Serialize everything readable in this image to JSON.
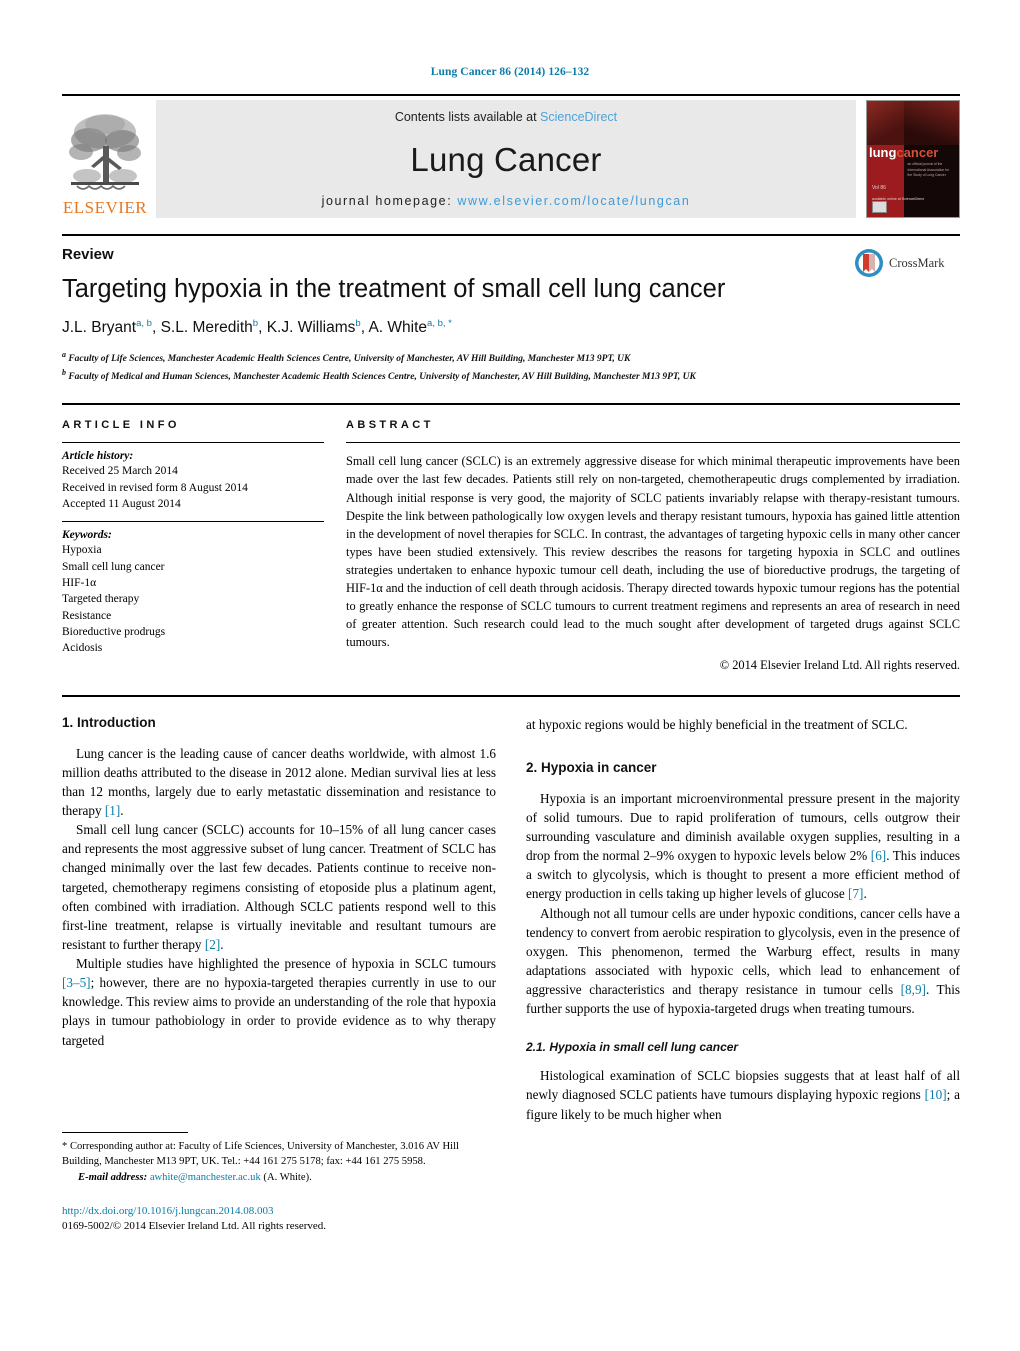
{
  "running_head": "Lung Cancer 86 (2014) 126–132",
  "masthead": {
    "contents_prefix": "Contents lists available at ",
    "contents_link": "ScienceDirect",
    "journal_title": "Lung Cancer",
    "homepage_prefix": "journal homepage: ",
    "homepage_url": "www.elsevier.com/locate/lungcan",
    "publisher": "ELSEVIER",
    "cover": {
      "title_part1": "lung",
      "title_part2": "cancer",
      "subtitle": "an official journal of the International Association for the Study of Lung Cancer",
      "issue_line": "Vol 86",
      "extra_line": "available online at ScienceDirect"
    }
  },
  "article": {
    "kind": "Review",
    "title": "Targeting hypoxia in the treatment of small cell lung cancer",
    "authors_plain": "J.L. Bryant, S.L. Meredith, K.J. Williams, A. White",
    "authors": [
      {
        "name": "J.L. Bryant",
        "marks": "a, b"
      },
      {
        "name": "S.L. Meredith",
        "marks": "b"
      },
      {
        "name": "K.J. Williams",
        "marks": "b"
      },
      {
        "name": "A. White",
        "marks": "a, b, *"
      }
    ],
    "affiliations": [
      {
        "mark": "a",
        "text": "Faculty of Life Sciences, Manchester Academic Health Sciences Centre, University of Manchester, AV Hill Building, Manchester M13 9PT, UK"
      },
      {
        "mark": "b",
        "text": "Faculty of Medical and Human Sciences, Manchester Academic Health Sciences Centre, University of Manchester, AV Hill Building, Manchester M13 9PT, UK"
      }
    ],
    "crossmark_label": "CrossMark"
  },
  "article_info": {
    "heading": "ARTICLE INFO",
    "history_head": "Article history:",
    "history": [
      "Received 25 March 2014",
      "Received in revised form 8 August 2014",
      "Accepted 11 August 2014"
    ],
    "keywords_head": "Keywords:",
    "keywords": [
      "Hypoxia",
      "Small cell lung cancer",
      "HIF-1α",
      "Targeted therapy",
      "Resistance",
      "Bioreductive prodrugs",
      "Acidosis"
    ]
  },
  "abstract": {
    "heading": "ABSTRACT",
    "text": "Small cell lung cancer (SCLC) is an extremely aggressive disease for which minimal therapeutic improvements have been made over the last few decades. Patients still rely on non-targeted, chemotherapeutic drugs complemented by irradiation. Although initial response is very good, the majority of SCLC patients invariably relapse with therapy-resistant tumours. Despite the link between pathologically low oxygen levels and therapy resistant tumours, hypoxia has gained little attention in the development of novel therapies for SCLC. In contrast, the advantages of targeting hypoxic cells in many other cancer types have been studied extensively. This review describes the reasons for targeting hypoxia in SCLC and outlines strategies undertaken to enhance hypoxic tumour cell death, including the use of bioreductive prodrugs, the targeting of HIF-1α and the induction of cell death through acidosis. Therapy directed towards hypoxic tumour regions has the potential to greatly enhance the response of SCLC tumours to current treatment regimens and represents an area of research in need of greater attention. Such research could lead to the much sought after development of targeted drugs against SCLC tumours.",
    "copyright": "© 2014 Elsevier Ireland Ltd. All rights reserved."
  },
  "body": {
    "left_column": {
      "section_heading": "1.  Introduction",
      "paragraphs": [
        {
          "segments": [
            {
              "t": "Lung cancer is the leading cause of cancer deaths worldwide, with almost 1.6 million deaths attributed to the disease in 2012 alone. Median survival lies at less than 12 months, largely due to early metastatic dissemination and resistance to therapy ",
              "k": "text"
            },
            {
              "t": "[1]",
              "k": "ref"
            },
            {
              "t": ".",
              "k": "text"
            }
          ]
        },
        {
          "segments": [
            {
              "t": "Small cell lung cancer (SCLC) accounts for 10–15% of all lung cancer cases and represents the most aggressive subset of lung cancer. Treatment of SCLC has changed minimally over the last few decades. Patients continue to receive non-targeted, chemotherapy regimens consisting of etoposide plus a platinum agent, often combined with irradiation. Although SCLC patients respond well to this first-line treatment, relapse is virtually inevitable and resultant tumours are resistant to further therapy ",
              "k": "text"
            },
            {
              "t": "[2]",
              "k": "ref"
            },
            {
              "t": ".",
              "k": "text"
            }
          ]
        },
        {
          "segments": [
            {
              "t": "Multiple studies have highlighted the presence of hypoxia in SCLC tumours ",
              "k": "text"
            },
            {
              "t": "[3–5]",
              "k": "ref"
            },
            {
              "t": "; however, there are no hypoxia-targeted therapies currently in use to our knowledge. This review aims to provide an understanding of the role that hypoxia plays in tumour pathobiology in order to provide evidence as to why therapy targeted",
              "k": "text"
            }
          ]
        }
      ]
    },
    "right_column": {
      "continued_paragraph": {
        "segments": [
          {
            "t": "at hypoxic regions would be highly beneficial in the treatment of SCLC.",
            "k": "text"
          }
        ]
      },
      "section_heading": "2.  Hypoxia in cancer",
      "paragraphs": [
        {
          "segments": [
            {
              "t": "Hypoxia is an important microenvironmental pressure present in the majority of solid tumours. Due to rapid proliferation of tumours, cells outgrow their surrounding vasculature and diminish available oxygen supplies, resulting in a drop from the normal 2–9% oxygen to hypoxic levels below 2% ",
              "k": "text"
            },
            {
              "t": "[6]",
              "k": "ref"
            },
            {
              "t": ". This induces a switch to glycolysis, which is thought to present a more efficient method of energy production in cells taking up higher levels of glucose ",
              "k": "text"
            },
            {
              "t": "[7]",
              "k": "ref"
            },
            {
              "t": ".",
              "k": "text"
            }
          ]
        },
        {
          "segments": [
            {
              "t": "Although not all tumour cells are under hypoxic conditions, cancer cells have a tendency to convert from aerobic respiration to glycolysis, even in the presence of oxygen. This phenomenon, termed the Warburg effect, results in many adaptations associated with hypoxic cells, which lead to enhancement of aggressive characteristics and therapy resistance in tumour cells ",
              "k": "text"
            },
            {
              "t": "[8,9]",
              "k": "ref"
            },
            {
              "t": ". This further supports the use of hypoxia-targeted drugs when treating tumours.",
              "k": "text"
            }
          ]
        }
      ],
      "subsection_heading": "2.1.  Hypoxia in small cell lung cancer",
      "subsection_paragraphs": [
        {
          "segments": [
            {
              "t": "Histological examination of SCLC biopsies suggests that at least half of all newly diagnosed SCLC patients have tumours displaying hypoxic regions ",
              "k": "text"
            },
            {
              "t": "[10]",
              "k": "ref"
            },
            {
              "t": "; a figure likely to be much higher when",
              "k": "text"
            }
          ]
        }
      ]
    }
  },
  "footnote": {
    "corresponding": "* Corresponding author at: Faculty of Life Sciences, University of Manchester, 3.016 AV Hill Building, Manchester M13 9PT, UK. Tel.: +44 161 275 5178; fax: +44 161 275 5958.",
    "email_label": "E-mail address:",
    "email": "awhite@manchester.ac.uk",
    "email_suffix": " (A. White).",
    "doi": "http://dx.doi.org/10.1016/j.lungcan.2014.08.003",
    "issn_line": "0169-5002/© 2014 Elsevier Ireland Ltd. All rights reserved."
  },
  "colors": {
    "accent_blue": "#0b7ca8",
    "link_blue": "#3f9ad6",
    "elsevier_orange": "#e87722",
    "masthead_grey": "#e9e9e9"
  }
}
